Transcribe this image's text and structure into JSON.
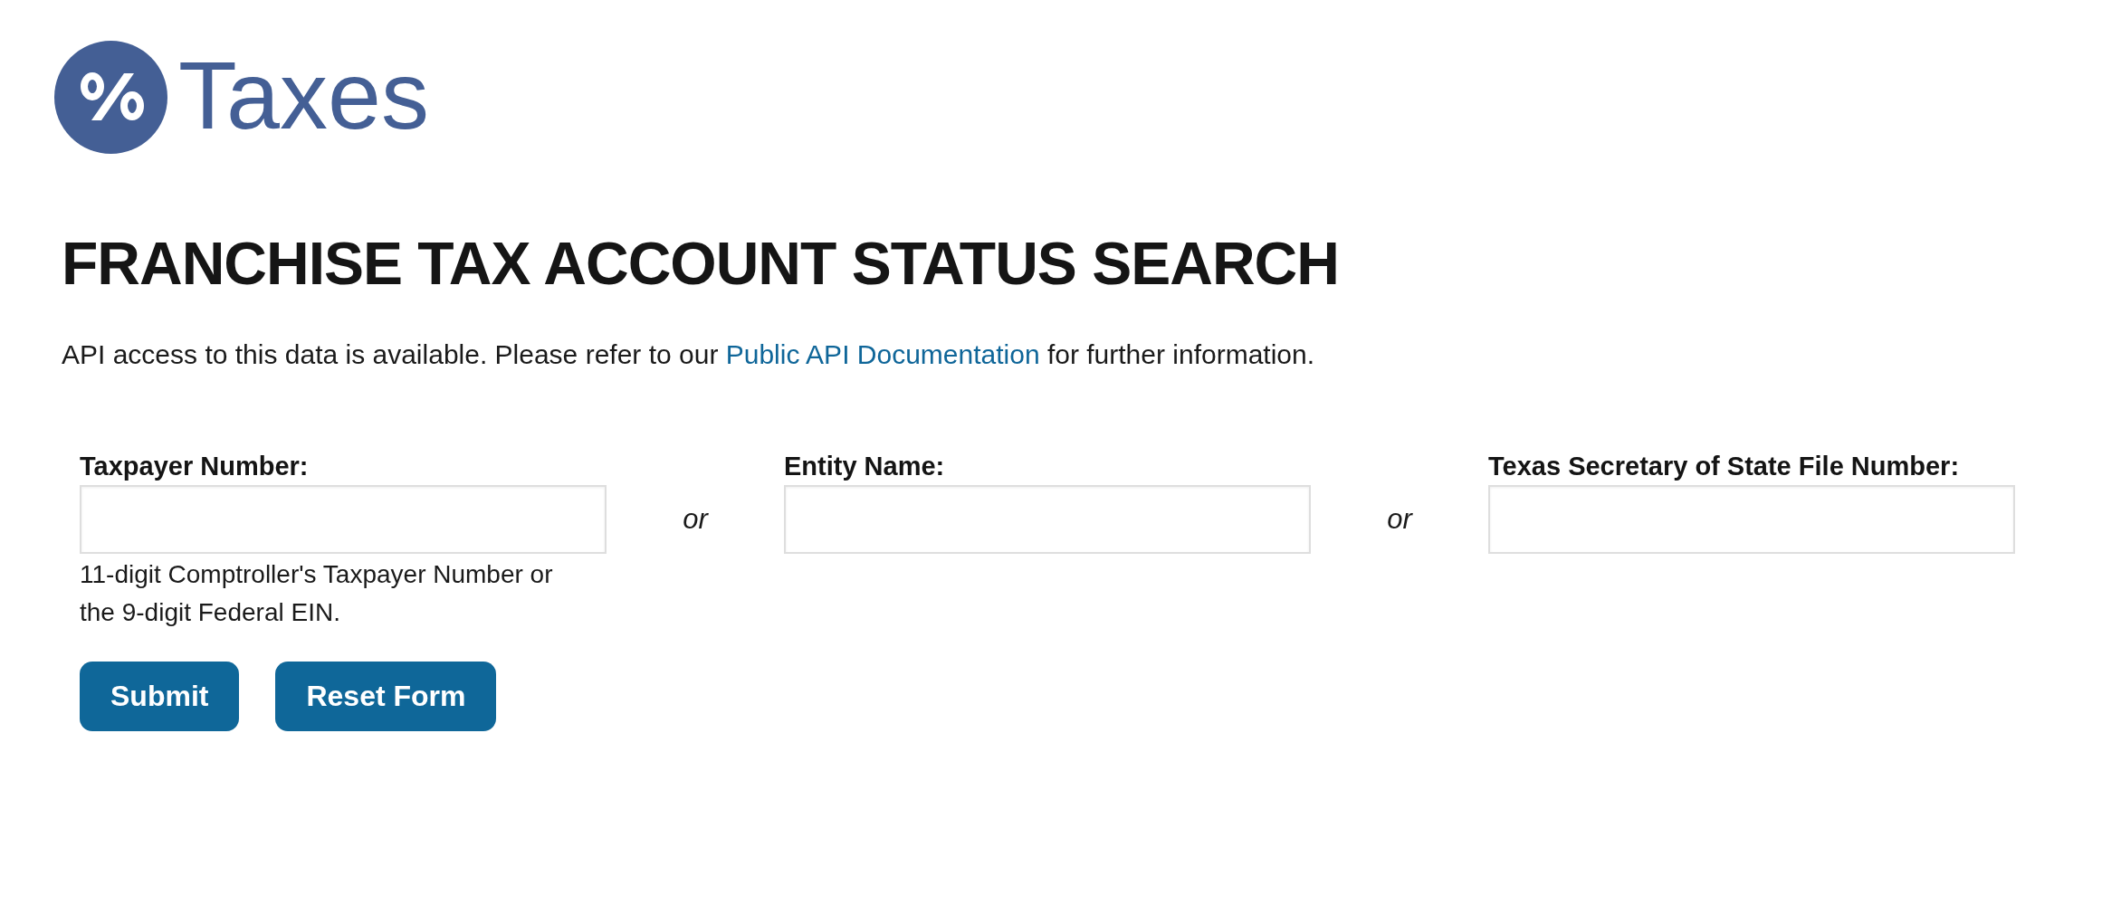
{
  "header": {
    "logo_text": "Taxes"
  },
  "title": "FRANCHISE TAX ACCOUNT STATUS SEARCH",
  "intro": {
    "before": "API access to this data is available. Please refer to our ",
    "link": "Public API Documentation",
    "after": " for further information."
  },
  "form": {
    "fields": [
      {
        "label": "Taxpayer Number:",
        "hint": "11-digit Comptroller's Taxpayer Number or the 9-digit Federal EIN."
      },
      {
        "label": "Entity Name:"
      },
      {
        "label": "Texas Secretary of State File Number:"
      }
    ],
    "separators": [
      "or",
      "or"
    ],
    "buttons": [
      "Submit",
      "Reset Form"
    ]
  }
}
